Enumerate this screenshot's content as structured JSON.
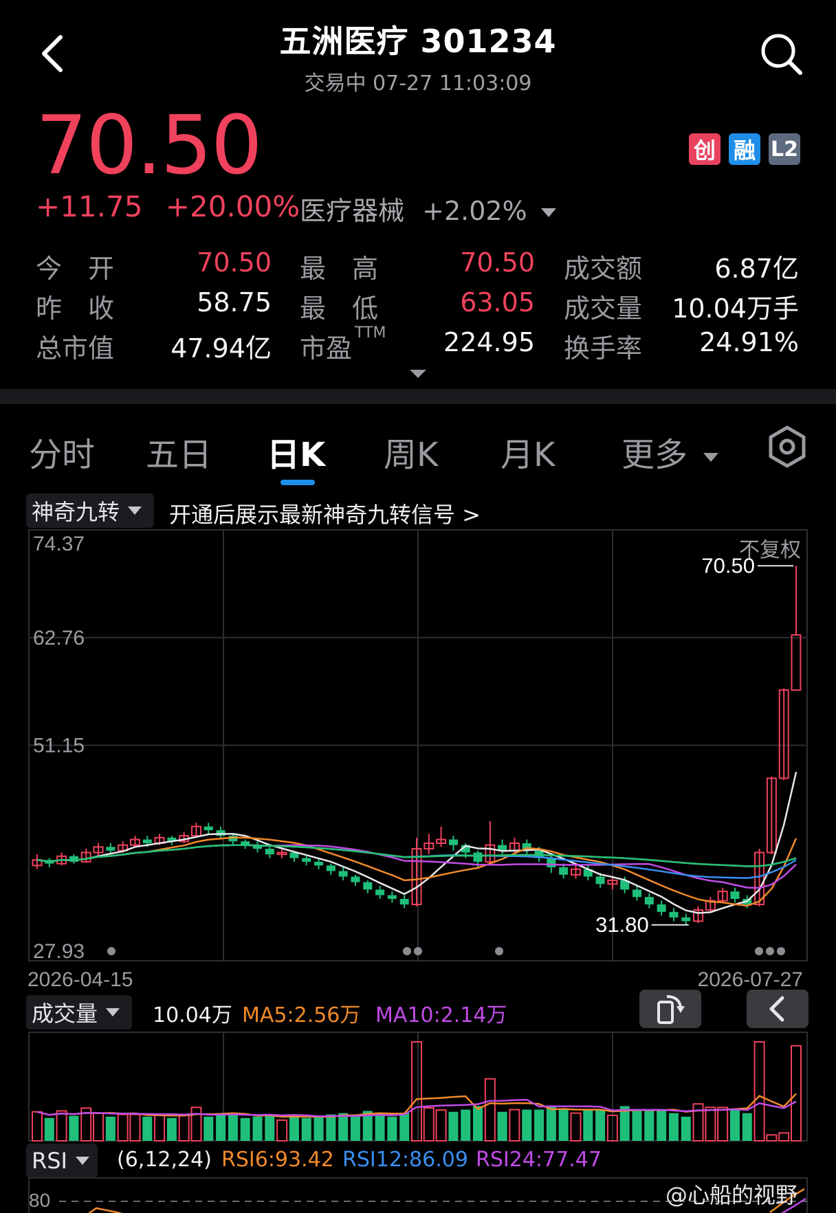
{
  "header": {
    "title": "五洲医疗 301234",
    "subtitle": "交易中 07-27 11:03:09",
    "back_icon": "chevron-left-icon",
    "search_icon": "search-icon"
  },
  "quote": {
    "price": "70.50",
    "change": "+11.75",
    "change_pct": "+20.00%",
    "sector_name": "医疗器械",
    "sector_pct": "+2.02%",
    "badges": [
      "创",
      "融",
      "L2"
    ],
    "colors": {
      "up": "#f0425d",
      "down": "#1fbf7a",
      "badge_chuang": "#e8435e",
      "badge_rong": "#1e8ee8",
      "badge_l2": "#5e6a7e"
    }
  },
  "stats": [
    {
      "label": "今　开",
      "value": "70.50",
      "color": "red"
    },
    {
      "label": "最　高",
      "value": "70.50",
      "color": "red"
    },
    {
      "label": "成交额",
      "value": "6.87亿",
      "color": "white"
    },
    {
      "label": "昨　收",
      "value": "58.75",
      "color": "white"
    },
    {
      "label": "最　低",
      "value": "63.05",
      "color": "red"
    },
    {
      "label": "成交量",
      "value": "10.04万手",
      "color": "white"
    },
    {
      "label": "总市值",
      "value": "47.94亿",
      "color": "white"
    },
    {
      "label": "市盈",
      "sup": "TTM",
      "value": "224.95",
      "color": "white"
    },
    {
      "label": "换手率",
      "value": "24.91%",
      "color": "white"
    }
  ],
  "tabs": [
    {
      "label": "分时",
      "active": false
    },
    {
      "label": "五日",
      "active": false
    },
    {
      "label": "日K",
      "active": true
    },
    {
      "label": "周K",
      "active": false
    },
    {
      "label": "月K",
      "active": false
    },
    {
      "label": "更多",
      "active": false
    }
  ],
  "settings_icon": "hexagon-gear-icon",
  "indicator": {
    "name": "神奇九转",
    "note": "开通后展示最新神奇九转信号 >"
  },
  "chart_data": {
    "type": "candlestick",
    "adjust_label": "不复权",
    "y_ticks": [
      "74.37",
      "62.76",
      "51.15",
      "27.93"
    ],
    "ylim": [
      27.93,
      74.37
    ],
    "x_start": "2026-04-15",
    "x_end": "2026-07-27",
    "high_marker": "70.50",
    "low_marker": "31.80",
    "candles": [
      [
        38.2,
        38.8,
        37.8,
        39.4
      ],
      [
        38.8,
        38.4,
        38.0,
        39.0
      ],
      [
        38.4,
        39.2,
        38.2,
        39.6
      ],
      [
        39.2,
        38.6,
        38.4,
        39.4
      ],
      [
        38.6,
        39.6,
        38.5,
        40.0
      ],
      [
        39.6,
        40.2,
        39.2,
        40.6
      ],
      [
        40.2,
        39.8,
        39.4,
        40.6
      ],
      [
        39.8,
        40.4,
        39.6,
        40.8
      ],
      [
        40.4,
        41.0,
        40.2,
        41.4
      ],
      [
        41.0,
        40.6,
        40.2,
        41.4
      ],
      [
        40.6,
        41.2,
        40.4,
        41.6
      ],
      [
        41.2,
        40.8,
        40.4,
        41.4
      ],
      [
        40.8,
        41.4,
        40.6,
        41.8
      ],
      [
        41.4,
        42.4,
        41.2,
        42.8
      ],
      [
        42.4,
        42.0,
        41.6,
        42.8
      ],
      [
        42.0,
        41.4,
        41.0,
        42.4
      ],
      [
        41.4,
        40.8,
        40.4,
        41.6
      ],
      [
        40.8,
        40.4,
        40.0,
        41.0
      ],
      [
        40.4,
        40.0,
        39.6,
        40.8
      ],
      [
        40.0,
        39.4,
        39.0,
        40.2
      ],
      [
        39.4,
        39.6,
        39.0,
        40.0
      ],
      [
        39.6,
        39.0,
        38.6,
        39.8
      ],
      [
        39.0,
        38.6,
        38.2,
        39.2
      ],
      [
        38.6,
        38.2,
        37.8,
        39.0
      ],
      [
        38.2,
        37.6,
        37.2,
        38.4
      ],
      [
        37.6,
        37.0,
        36.6,
        38.0
      ],
      [
        37.0,
        36.4,
        36.0,
        37.2
      ],
      [
        36.4,
        35.6,
        35.2,
        36.6
      ],
      [
        35.6,
        35.0,
        34.6,
        36.0
      ],
      [
        35.0,
        34.6,
        34.2,
        35.4
      ],
      [
        34.6,
        34.0,
        33.6,
        35.0
      ],
      [
        34.0,
        40.0,
        33.8,
        41.2
      ],
      [
        40.0,
        40.6,
        39.4,
        41.6
      ],
      [
        40.6,
        41.0,
        40.2,
        42.4
      ],
      [
        41.0,
        40.4,
        39.8,
        41.4
      ],
      [
        40.4,
        39.6,
        39.0,
        40.6
      ],
      [
        39.6,
        38.6,
        38.0,
        39.8
      ],
      [
        38.6,
        40.4,
        38.4,
        43.0
      ],
      [
        40.4,
        39.8,
        39.4,
        41.0
      ],
      [
        39.8,
        40.6,
        39.6,
        41.2
      ],
      [
        40.6,
        39.8,
        39.4,
        41.0
      ],
      [
        39.8,
        39.0,
        38.6,
        40.2
      ],
      [
        39.0,
        38.0,
        37.4,
        39.2
      ],
      [
        38.0,
        37.2,
        36.8,
        38.4
      ],
      [
        37.2,
        37.8,
        36.8,
        38.2
      ],
      [
        37.8,
        37.0,
        36.6,
        38.2
      ],
      [
        37.0,
        36.2,
        35.8,
        37.4
      ],
      [
        36.2,
        36.6,
        35.6,
        37.0
      ],
      [
        36.6,
        35.6,
        35.2,
        37.0
      ],
      [
        35.6,
        34.8,
        34.4,
        36.0
      ],
      [
        34.8,
        34.0,
        33.6,
        35.2
      ],
      [
        34.0,
        33.2,
        32.8,
        34.4
      ],
      [
        33.2,
        32.6,
        32.2,
        33.6
      ],
      [
        32.6,
        32.2,
        31.8,
        33.0
      ],
      [
        32.2,
        33.4,
        32.0,
        33.8
      ],
      [
        33.4,
        34.4,
        33.2,
        34.8
      ],
      [
        34.4,
        35.4,
        34.2,
        35.8
      ],
      [
        35.4,
        34.6,
        34.2,
        35.8
      ],
      [
        34.6,
        34.0,
        33.6,
        35.0
      ],
      [
        34.0,
        39.6,
        33.8,
        40.0
      ],
      [
        39.6,
        47.6,
        39.4,
        47.8
      ],
      [
        47.6,
        57.1,
        47.4,
        57.3
      ],
      [
        57.1,
        63.05,
        63.05,
        70.5
      ]
    ]
  },
  "volume": {
    "name": "成交量",
    "value": "10.04万",
    "ma5": "MA5:2.56万",
    "ma10": "MA10:2.14万",
    "rotate_icon": "rotate-screen-icon",
    "collapse_icon": "chevron-left-icon"
  },
  "rsi": {
    "name": "RSI",
    "params": "(6,12,24)",
    "rsi6": "RSI6:93.42",
    "rsi12": "RSI12:86.09",
    "rsi24": "RSI24:77.47",
    "tick": "80"
  },
  "watermark": "@心船的视野"
}
